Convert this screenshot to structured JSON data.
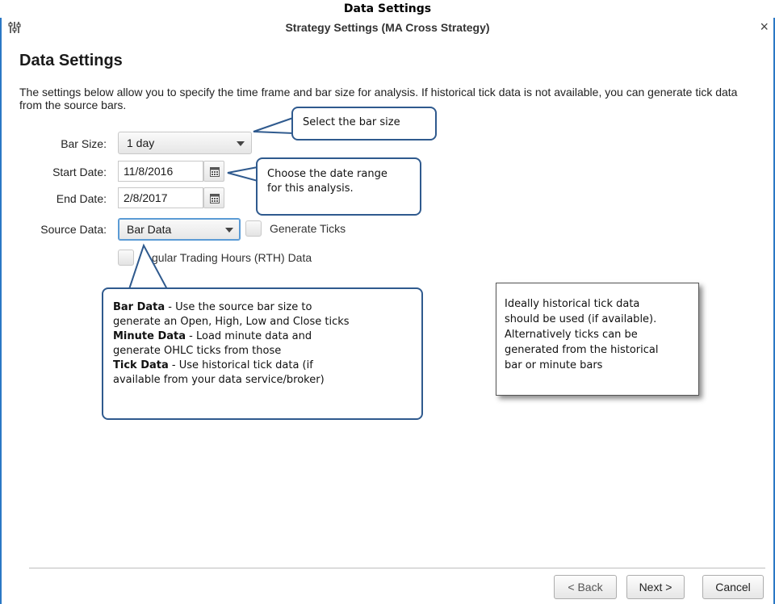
{
  "caption": "Data Settings",
  "window": {
    "title": "Strategy Settings (MA Cross Strategy)",
    "close_glyph": "×",
    "app_icon": "sliders-icon"
  },
  "heading": "Data Settings",
  "description": "The settings below allow you to specify the time frame and bar size for analysis.  If historical tick data is not available, you can generate tick data from the source bars.",
  "form": {
    "bar_size": {
      "label": "Bar Size:",
      "value": "1 day"
    },
    "start_date": {
      "label": "Start Date:",
      "value": "11/8/2016"
    },
    "end_date": {
      "label": "End Date:",
      "value": "2/8/2017"
    },
    "source_data": {
      "label": "Source Data:",
      "value": "Bar Data"
    },
    "generate_ticks": {
      "label": "Generate Ticks",
      "checked": false
    },
    "rth": {
      "label_visible": "gular Trading Hours (RTH) Data",
      "checked": false
    }
  },
  "callouts": {
    "bar_size": "Select the bar size",
    "date_range_line1": "Choose the date range",
    "date_range_line2": "for this analysis.",
    "source": {
      "bar_data_title": "Bar Data",
      "bar_data_text_line1": " - Use the source bar size to",
      "bar_data_text_line2": "generate an Open, High, Low and Close ticks",
      "minute_data_title": "Minute Data",
      "minute_data_text_line1": " - Load minute data and",
      "minute_data_text_line2": "generate OHLC ticks from those",
      "tick_data_title": "Tick Data",
      "tick_data_text_line1": " - Use historical tick data (if",
      "tick_data_text_line2": "available from your data service/broker)"
    }
  },
  "note": {
    "line1": "Ideally historical tick data",
    "line2": "should be used (if available).",
    "line3": "Alternatively ticks can be",
    "line4": "generated from the historical",
    "line5": "bar or minute bars"
  },
  "buttons": {
    "back": "< Back",
    "next": "Next >",
    "cancel": "Cancel"
  },
  "colors": {
    "window_border": "#2b78c5",
    "callout_border": "#2f5a8e",
    "focus": "#5b9bd5"
  }
}
